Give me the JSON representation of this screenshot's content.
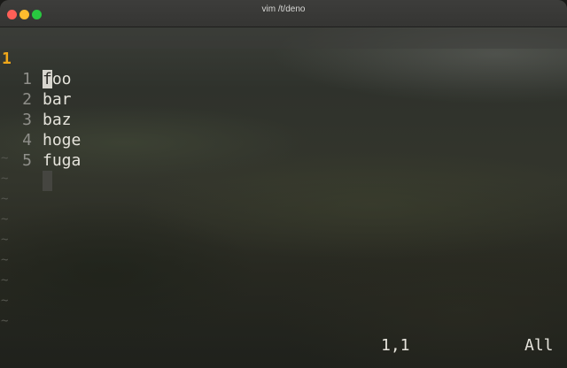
{
  "window": {
    "title": "vim /t/deno"
  },
  "buffer": {
    "current_line_number": "1",
    "lines": [
      {
        "number": "",
        "text": "oo",
        "cursor_char": "f"
      },
      {
        "number": "1",
        "text": "bar"
      },
      {
        "number": "2",
        "text": "baz"
      },
      {
        "number": "3",
        "text": "hoge"
      },
      {
        "number": "4",
        "text": "fuga"
      },
      {
        "number": "5",
        "text": ""
      }
    ],
    "empty_line_marker": "~"
  },
  "statusline": {
    "position": "1,1",
    "scroll": "All"
  },
  "colors": {
    "current_line_number": "#f0a81a",
    "line_number": "#8f8f8a",
    "text": "#e6e4dc"
  }
}
